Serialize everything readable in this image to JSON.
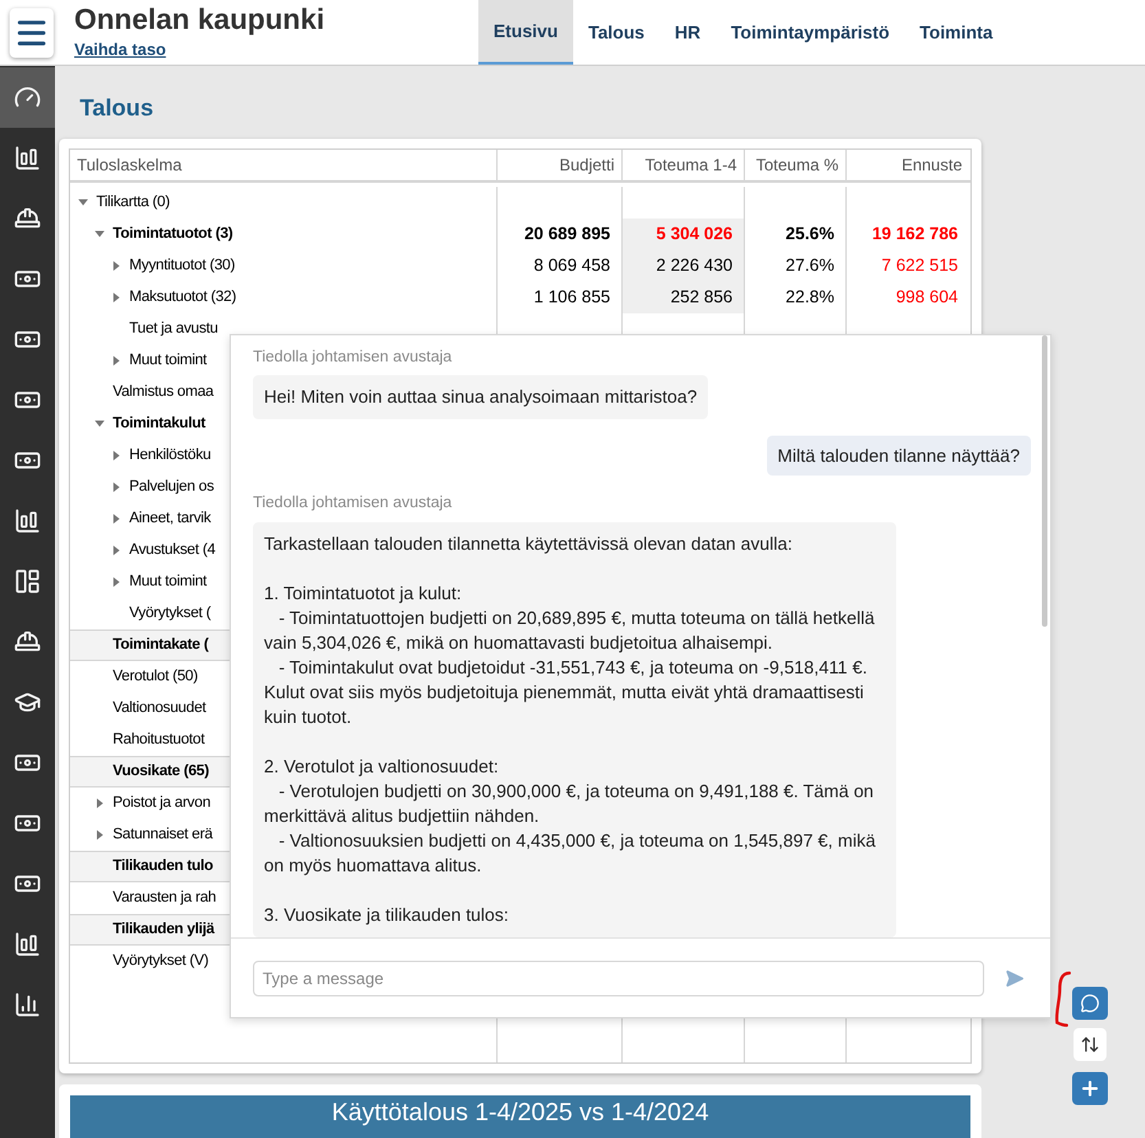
{
  "header": {
    "title": "Onnelan kaupunki",
    "link": "Vaihda taso"
  },
  "tabs": [
    {
      "label": "Etusivu",
      "selected": true
    },
    {
      "label": "Talous",
      "selected": false
    },
    {
      "label": "HR",
      "selected": false
    },
    {
      "label": "Toimintaympäristö",
      "selected": false
    },
    {
      "label": "Toiminta",
      "selected": false
    }
  ],
  "sidebar": {
    "items": [
      {
        "kind": "gauge",
        "selected": true
      },
      {
        "kind": "chart",
        "selected": false
      },
      {
        "kind": "worker",
        "selected": false
      },
      {
        "kind": "money",
        "selected": false
      },
      {
        "kind": "money",
        "selected": false
      },
      {
        "kind": "money",
        "selected": false
      },
      {
        "kind": "money",
        "selected": false
      },
      {
        "kind": "chart",
        "selected": false
      },
      {
        "kind": "layout",
        "selected": false
      },
      {
        "kind": "worker",
        "selected": false
      },
      {
        "kind": "graduate",
        "selected": false
      },
      {
        "kind": "money",
        "selected": false
      },
      {
        "kind": "money",
        "selected": false
      },
      {
        "kind": "money",
        "selected": false
      },
      {
        "kind": "chart",
        "selected": false
      },
      {
        "kind": "bars",
        "selected": false
      }
    ]
  },
  "page_title": "Talous",
  "table": {
    "columns": [
      "Tuloslaskelma",
      "Budjetti",
      "Toteuma 1-4",
      "Toteuma %",
      "Ennuste"
    ],
    "rows": [
      {
        "label": "Tilikartta (0)",
        "kind": "item",
        "expanded": true,
        "children": [
          {
            "label": "Toimintatuotot (3)",
            "kind": "group",
            "expanded": true,
            "values": [
              {
                "text": "20 689 895",
                "alert": false
              },
              {
                "text": "5 304 026",
                "alert": true
              },
              {
                "text": "25.6%",
                "alert": false
              },
              {
                "text": "19 162 786",
                "alert": true
              }
            ],
            "children": [
              {
                "label": "Myyntituotot (30)",
                "kind": "item",
                "expanded": false,
                "values": [
                  {
                    "text": "8 069 458",
                    "alert": false
                  },
                  {
                    "text": "2 226 430",
                    "alert": false
                  },
                  {
                    "text": "27.6%",
                    "alert": false
                  },
                  {
                    "text": "7 622 515",
                    "alert": true
                  }
                ]
              },
              {
                "label": "Maksutuotot (32)",
                "kind": "item",
                "expanded": false,
                "values": [
                  {
                    "text": "1 106 855",
                    "alert": false
                  },
                  {
                    "text": "252 856",
                    "alert": false
                  },
                  {
                    "text": "22.8%",
                    "alert": false
                  },
                  {
                    "text": "998 604",
                    "alert": true
                  }
                ]
              },
              {
                "label": "Tuet ja avustu",
                "kind": "item"
              },
              {
                "label": "Muut toimint",
                "kind": "item",
                "expanded": false
              }
            ]
          },
          {
            "label": "Valmistus omaa",
            "kind": "item"
          },
          {
            "label": "Toimintakulut",
            "kind": "group",
            "expanded": true,
            "children": [
              {
                "label": "Henkilöstöku",
                "kind": "item",
                "expanded": false
              },
              {
                "label": "Palvelujen os",
                "kind": "item",
                "expanded": false
              },
              {
                "label": "Aineet, tarvik",
                "kind": "item",
                "expanded": false
              },
              {
                "label": "Avustukset (4",
                "kind": "item",
                "expanded": false
              },
              {
                "label": "Muut toimint",
                "kind": "item",
                "expanded": false
              },
              {
                "label": "Vyörytykset (",
                "kind": "item"
              }
            ]
          },
          {
            "label": "Toimintakate (",
            "kind": "total"
          },
          {
            "label": "Verotulot (50)",
            "kind": "item"
          },
          {
            "label": "Valtionosuudet",
            "kind": "item"
          },
          {
            "label": "Rahoitustuotot",
            "kind": "item"
          },
          {
            "label": "Vuosikate (65)",
            "kind": "total"
          },
          {
            "label": "Poistot ja arvon",
            "kind": "item",
            "expanded": false
          },
          {
            "label": "Satunnaiset erä",
            "kind": "item",
            "expanded": false
          },
          {
            "label": "Tilikauden tulo",
            "kind": "total"
          },
          {
            "label": "Varausten ja rah",
            "kind": "item"
          },
          {
            "label": "Tilikauden ylijä",
            "kind": "total"
          },
          {
            "label": "Vyörytykset (V)",
            "kind": "item"
          }
        ]
      }
    ]
  },
  "chat": {
    "messages": [
      {
        "kind": "assistant",
        "sender": "Tiedolla johtamisen avustaja",
        "text": "Hei! Miten voin auttaa sinua analysoimaan mittaristoa?"
      },
      {
        "kind": "user",
        "text": "Miltä talouden tilanne näyttää?"
      },
      {
        "kind": "assistant",
        "sender": "Tiedolla johtamisen avustaja",
        "text": "Tarkastellaan talouden tilannetta käytettävissä olevan datan avulla:\n\n1. Toimintatuotot ja kulut:\n   - Toimintatuottojen budjetti on 20,689,895 €, mutta toteuma on tällä hetkellä vain 5,304,026 €, mikä on huomattavasti budjetoitua alhaisempi.\n   - Toimintakulut ovat budjetoidut -31,551,743 €, ja toteuma on -9,518,411 €. Kulut ovat siis myös budjetoituja pienemmät, mutta eivät yhtä dramaattisesti kuin tuotot.\n\n2. Verotulot ja valtionosuudet:\n   - Verotulojen budjetti on 30,900,000 €, ja toteuma on 9,491,188 €. Tämä on merkittävä alitus budjettiin nähden.\n   - Valtionosuuksien budjetti on 4,435,000 €, ja toteuma on 1,545,897 €, mikä on myös huomattava alitus.\n\n3. Vuosikate ja tilikauden tulos:"
      }
    ],
    "input": {
      "placeholder": "Type a message"
    }
  },
  "next_card": {
    "title": "Käyttötalous 1-4/2025 vs 1-4/2024"
  }
}
